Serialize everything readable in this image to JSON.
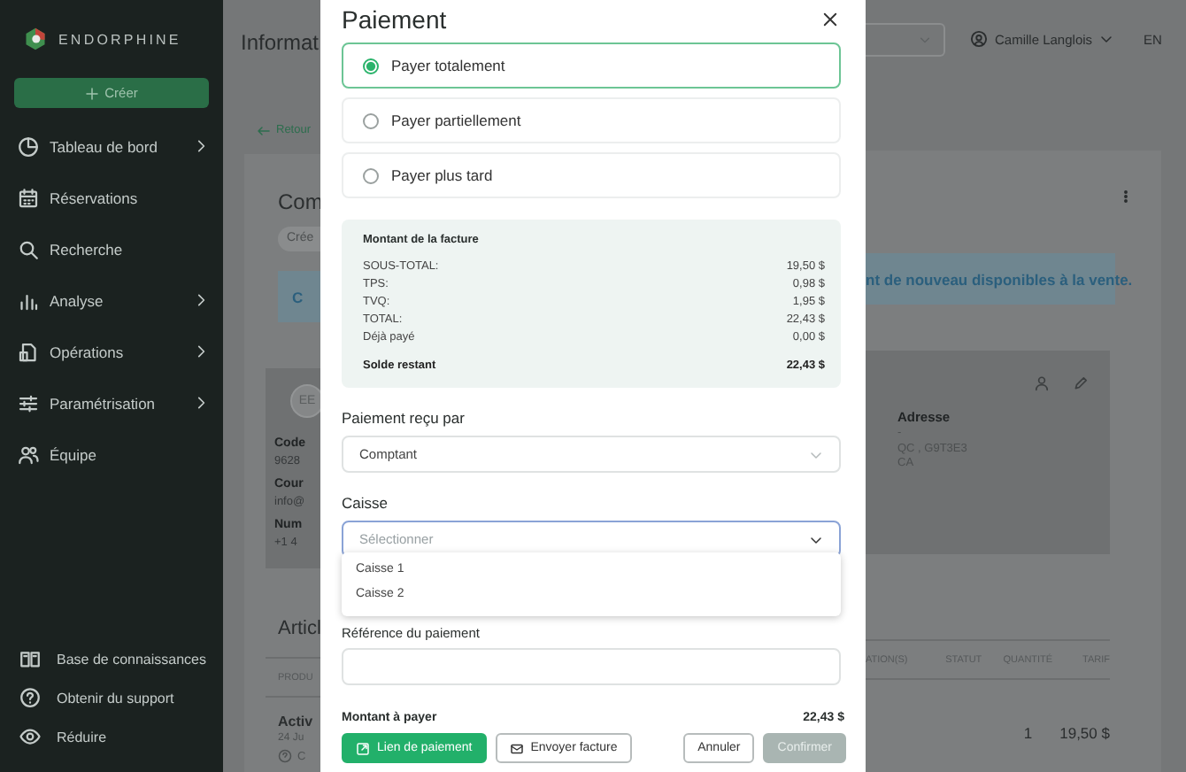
{
  "sidebar": {
    "brand": "ENDORPHINE",
    "create_button": "Créer",
    "items": [
      {
        "label": "Tableau de bord",
        "expandable": true
      },
      {
        "label": "Réservations",
        "expandable": false
      },
      {
        "label": "Recherche",
        "expandable": false
      },
      {
        "label": "Analyse",
        "expandable": true
      },
      {
        "label": "Opérations",
        "expandable": true
      },
      {
        "label": "Paramétrisation",
        "expandable": true
      },
      {
        "label": "Équipe",
        "expandable": false
      }
    ],
    "footer_items": [
      {
        "label": "Base de connaissances"
      },
      {
        "label": "Obtenir du support"
      },
      {
        "label": "Réduire"
      }
    ]
  },
  "page_left": {
    "title": "Informat",
    "back_link": "Retour",
    "card_title": "Com",
    "status_chip": "Crée",
    "banner_text": "C",
    "avatar": "EE",
    "fields": [
      {
        "label": "Code",
        "value": "9628"
      },
      {
        "label": "Cour",
        "value": "info@"
      },
      {
        "label": "Num",
        "value": "+1 4"
      }
    ],
    "section_title": "Articl",
    "table_header": "PRODU",
    "row": {
      "title": "Activ",
      "subtitle": "24 Ju",
      "note": "C"
    }
  },
  "page_right": {
    "topbar": {
      "user": "Camille Langlois",
      "language": "EN"
    },
    "banner_text": "nt de nouveau disponibles à la vente.",
    "address": {
      "label": "Adresse",
      "lines": [
        "-",
        "QC , G9T3E3",
        "CA"
      ]
    },
    "table": {
      "columns": [
        "ATION(S)",
        "STATUT",
        "QUANTITÉ",
        "TARIF"
      ],
      "row": {
        "quantity": "1",
        "price": "19,50 $"
      }
    }
  },
  "modal": {
    "title": "Paiement",
    "options": [
      {
        "label": "Payer totalement",
        "selected": true
      },
      {
        "label": "Payer partiellement",
        "selected": false
      },
      {
        "label": "Payer plus tard",
        "selected": false
      }
    ],
    "summary": {
      "title": "Montant de la facture",
      "rows": [
        {
          "label": "SOUS-TOTAL:",
          "value": "19,50 $",
          "bold": false
        },
        {
          "label": "TPS:",
          "value": "0,98 $",
          "bold": false
        },
        {
          "label": "TVQ:",
          "value": "1,95 $",
          "bold": false
        },
        {
          "label": "TOTAL:",
          "value": "22,43 $",
          "bold": false
        },
        {
          "label": "Déjà payé",
          "value": "0,00 $",
          "bold": false
        },
        {
          "label": "Solde restant",
          "value": "22,43 $",
          "bold": true
        }
      ]
    },
    "received_by": {
      "label": "Paiement reçu par",
      "value": "Comptant"
    },
    "register": {
      "label": "Caisse",
      "placeholder": "Sélectionner",
      "expanded": true,
      "options": [
        "Caisse 1",
        "Caisse 2"
      ]
    },
    "reference": {
      "label": "Référence du paiement"
    },
    "amount": {
      "label": "Montant à payer",
      "value": "22,43 $"
    },
    "buttons": [
      {
        "label": "Lien de paiement",
        "kind": "primary",
        "disabled": false
      },
      {
        "label": "Envoyer facture",
        "kind": "outline",
        "disabled": false
      },
      {
        "label": "Annuler",
        "kind": "outline",
        "disabled": false
      },
      {
        "label": "Confirmer",
        "kind": "primary",
        "disabled": true
      }
    ]
  }
}
